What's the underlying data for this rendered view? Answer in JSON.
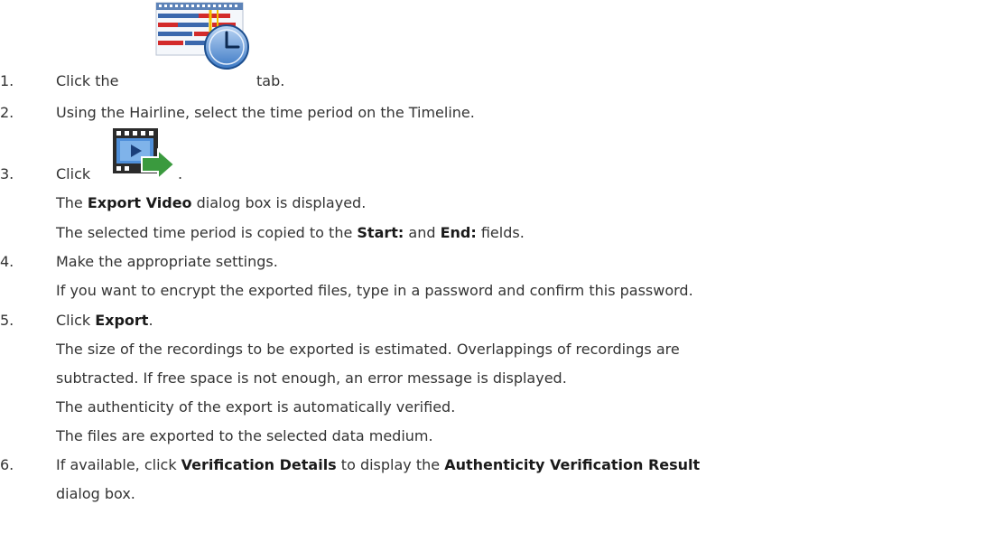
{
  "steps": [
    {
      "number": "1.",
      "before": "Click the",
      "after": "tab.",
      "icon": "timeline-tab-icon"
    },
    {
      "number": "2.",
      "text": "Using the Hairline, select the time period on the Timeline."
    },
    {
      "number": "3.",
      "before": "Click",
      "after": ".",
      "icon": "export-video-icon",
      "lines": [
        {
          "before": "The ",
          "bold": "Export Video",
          "after": " dialog box is displayed."
        },
        {
          "before": "The selected time period is copied to the ",
          "bold1": "Start:",
          "middle": " and ",
          "bold2": "End:",
          "after": " fields."
        }
      ]
    },
    {
      "number": "4.",
      "text": "Make the appropriate settings.",
      "lines": [
        "If you want to encrypt the exported files, type in a password and confirm this password."
      ]
    },
    {
      "number": "5.",
      "before": "Click ",
      "bold": "Export",
      "after": ".",
      "lines": [
        "The size of the recordings to be exported is estimated. Overlappings of recordings are",
        "subtracted. If free space is not enough, an error message is displayed.",
        "The authenticity of the export is automatically verified.",
        "The files are exported to the selected data medium."
      ]
    },
    {
      "number": "6.",
      "before": "If available, click ",
      "bold1": "Verification Details",
      "middle": " to display the ",
      "bold2": "Authenticity Verification Result",
      "lines": [
        "dialog box."
      ]
    }
  ],
  "colors": {
    "text": "#333333",
    "icon_blue": "#2f6fb5",
    "icon_red": "#d0262b",
    "icon_green": "#3a9a3e"
  }
}
